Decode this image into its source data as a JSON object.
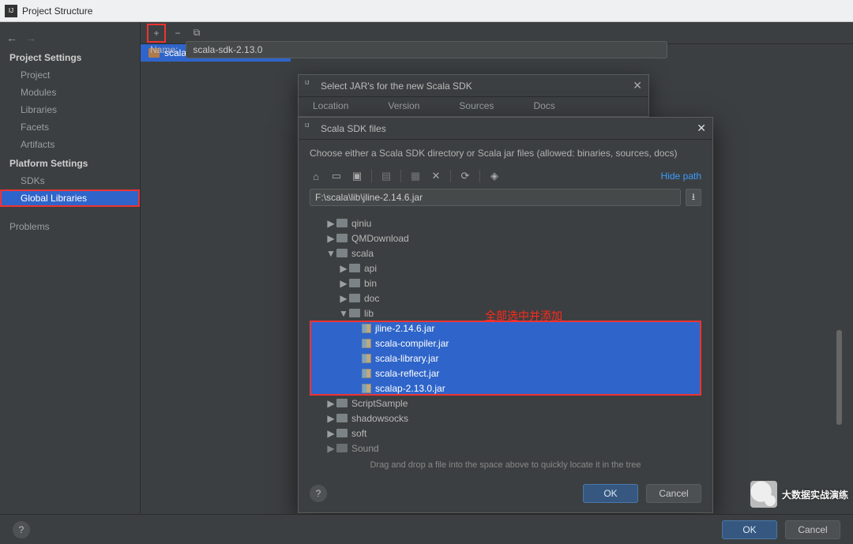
{
  "window": {
    "title": "Project Structure"
  },
  "sidebar": {
    "settings_header": "Project Settings",
    "platform_header": "Platform Settings",
    "project_items": [
      "Project",
      "Modules",
      "Libraries",
      "Facets",
      "Artifacts"
    ],
    "platform_items": [
      "SDKs",
      "Global Libraries"
    ],
    "problems": "Problems",
    "selected": "Global Libraries"
  },
  "toolbar": {
    "add": "+",
    "remove": "−",
    "copy": "⧉"
  },
  "library": {
    "name_label": "Name:",
    "name_value": "scala-sdk-2.13.0",
    "list_label": "scala-sdk-2.13.0"
  },
  "dialog1": {
    "title": "Select JAR's for the new Scala SDK",
    "tabs": [
      "Location",
      "Version",
      "Sources",
      "Docs"
    ]
  },
  "dialog2": {
    "title": "Scala SDK files",
    "message": "Choose either a Scala SDK directory or Scala jar files (allowed: binaries, sources, docs)",
    "hide_path": "Hide path",
    "path": "F:\\scala\\lib\\jline-2.14.6.jar",
    "tree": {
      "top": [
        "qiniu",
        "QMDownload"
      ],
      "scala_label": "scala",
      "scala_children": [
        "api",
        "bin",
        "doc"
      ],
      "lib_label": "lib",
      "lib_files": [
        "jline-2.14.6.jar",
        "scala-compiler.jar",
        "scala-library.jar",
        "scala-reflect.jar",
        "scalap-2.13.0.jar"
      ],
      "after": [
        "ScriptSample",
        "shadowsocks",
        "soft",
        "Sound"
      ]
    },
    "annotation": "全部选中并添加",
    "hint": "Drag and drop a file into the space above to quickly locate it in the tree",
    "ok": "OK",
    "cancel": "Cancel",
    "help": "?"
  },
  "bottom": {
    "ok": "OK",
    "cancel": "Cancel",
    "help": "?"
  },
  "watermark": "大数据实战演练"
}
